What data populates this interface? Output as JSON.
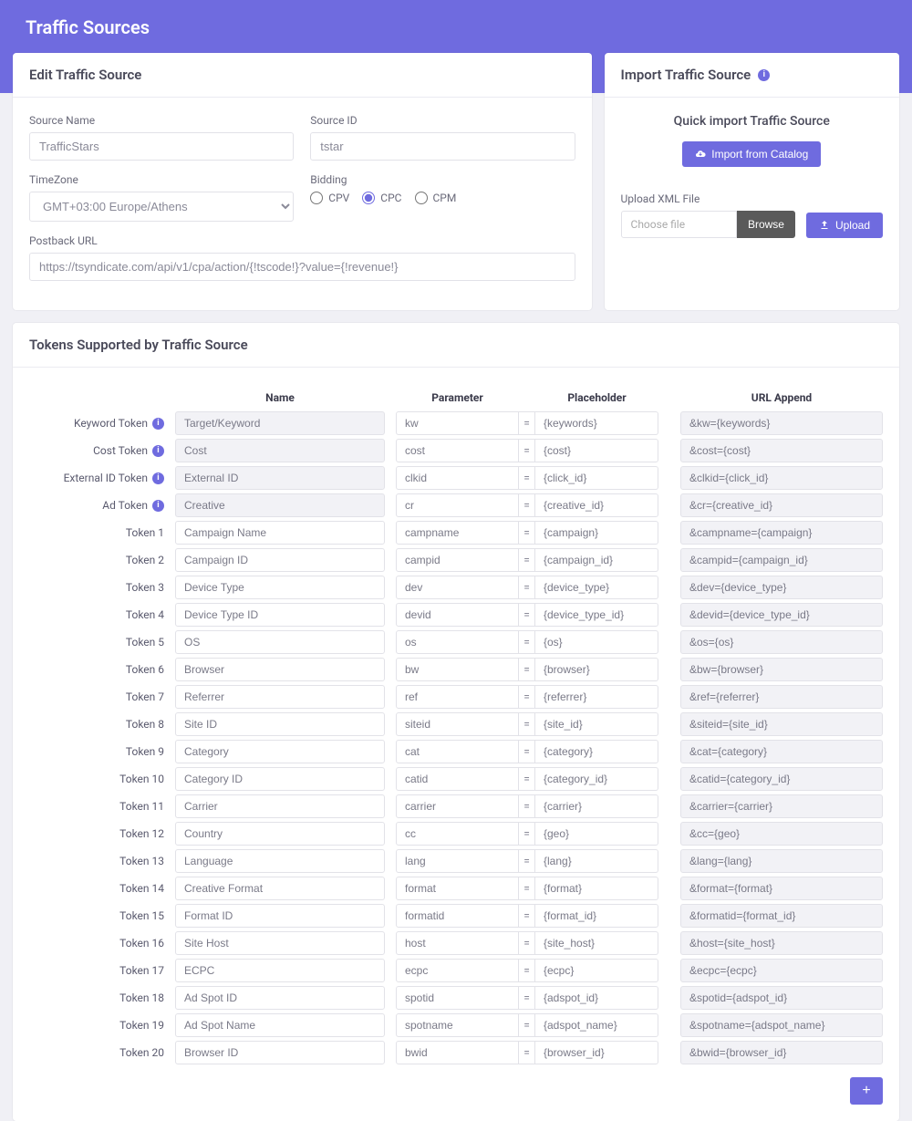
{
  "header": {
    "title": "Traffic Sources"
  },
  "edit": {
    "title": "Edit Traffic Source",
    "source_name_label": "Source Name",
    "source_name_value": "TrafficStars",
    "source_id_label": "Source ID",
    "source_id_value": "tstar",
    "timezone_label": "TimeZone",
    "timezone_value": "GMT+03:00 Europe/Athens",
    "bidding_label": "Bidding",
    "bidding_options": {
      "cpv": "CPV",
      "cpc": "CPC",
      "cpm": "CPM"
    },
    "bidding_selected": "CPC",
    "postback_label": "Postback URL",
    "postback_value": "https://tsyndicate.com/api/v1/cpa/action/{!tscode!}?value={!revenue!}"
  },
  "import": {
    "title": "Import Traffic Source",
    "quick_title": "Quick import Traffic Source",
    "catalog_btn": "Import from Catalog",
    "upload_label": "Upload XML File",
    "choose_file": "Choose file",
    "browse_btn": "Browse",
    "upload_btn": "Upload"
  },
  "tokens": {
    "title": "Tokens Supported by Traffic Source",
    "headers": {
      "name": "Name",
      "parameter": "Parameter",
      "placeholder": "Placeholder",
      "append": "URL Append"
    },
    "rows": [
      {
        "label": "Keyword Token",
        "info": true,
        "ro": true,
        "name": "Target/Keyword",
        "param": "kw",
        "plh": "{keywords}",
        "append": "&kw={keywords}"
      },
      {
        "label": "Cost Token",
        "info": true,
        "ro": true,
        "name": "Cost",
        "param": "cost",
        "plh": "{cost}",
        "append": "&cost={cost}"
      },
      {
        "label": "External ID Token",
        "info": true,
        "ro": true,
        "name": "External ID",
        "param": "clkid",
        "plh": "{click_id}",
        "append": "&clkid={click_id}"
      },
      {
        "label": "Ad Token",
        "info": true,
        "ro": true,
        "name": "Creative",
        "param": "cr",
        "plh": "{creative_id}",
        "append": "&cr={creative_id}"
      },
      {
        "label": "Token 1",
        "name": "Campaign Name",
        "param": "campname",
        "plh": "{campaign}",
        "append": "&campname={campaign}"
      },
      {
        "label": "Token 2",
        "name": "Campaign ID",
        "param": "campid",
        "plh": "{campaign_id}",
        "append": "&campid={campaign_id}"
      },
      {
        "label": "Token 3",
        "name": "Device Type",
        "param": "dev",
        "plh": "{device_type}",
        "append": "&dev={device_type}"
      },
      {
        "label": "Token 4",
        "name": "Device Type ID",
        "param": "devid",
        "plh": "{device_type_id}",
        "append": "&devid={device_type_id}"
      },
      {
        "label": "Token 5",
        "name": "OS",
        "param": "os",
        "plh": "{os}",
        "append": "&os={os}"
      },
      {
        "label": "Token 6",
        "name": "Browser",
        "param": "bw",
        "plh": "{browser}",
        "append": "&bw={browser}"
      },
      {
        "label": "Token 7",
        "name": "Referrer",
        "param": "ref",
        "plh": "{referrer}",
        "append": "&ref={referrer}"
      },
      {
        "label": "Token 8",
        "name": "Site ID",
        "param": "siteid",
        "plh": "{site_id}",
        "append": "&siteid={site_id}"
      },
      {
        "label": "Token 9",
        "name": "Category",
        "param": "cat",
        "plh": "{category}",
        "append": "&cat={category}"
      },
      {
        "label": "Token 10",
        "name": "Category ID",
        "param": "catid",
        "plh": "{category_id}",
        "append": "&catid={category_id}"
      },
      {
        "label": "Token 11",
        "name": "Carrier",
        "param": "carrier",
        "plh": "{carrier}",
        "append": "&carrier={carrier}"
      },
      {
        "label": "Token 12",
        "name": "Country",
        "param": "cc",
        "plh": "{geo}",
        "append": "&cc={geo}"
      },
      {
        "label": "Token 13",
        "name": "Language",
        "param": "lang",
        "plh": "{lang}",
        "append": "&lang={lang}"
      },
      {
        "label": "Token 14",
        "name": "Creative Format",
        "param": "format",
        "plh": "{format}",
        "append": "&format={format}"
      },
      {
        "label": "Token 15",
        "name": "Format ID",
        "param": "formatid",
        "plh": "{format_id}",
        "append": "&formatid={format_id}"
      },
      {
        "label": "Token 16",
        "name": "Site Host",
        "param": "host",
        "plh": "{site_host}",
        "append": "&host={site_host}"
      },
      {
        "label": "Token 17",
        "name": "ECPC",
        "param": "ecpc",
        "plh": "{ecpc}",
        "append": "&ecpc={ecpc}"
      },
      {
        "label": "Token 18",
        "name": "Ad Spot ID",
        "param": "spotid",
        "plh": "{adspot_id}",
        "append": "&spotid={adspot_id}"
      },
      {
        "label": "Token 19",
        "name": "Ad Spot Name",
        "param": "spotname",
        "plh": "{adspot_name}",
        "append": "&spotname={adspot_name}"
      },
      {
        "label": "Token 20",
        "name": "Browser ID",
        "param": "bwid",
        "plh": "{browser_id}",
        "append": "&bwid={browser_id}"
      }
    ]
  },
  "add_btn": "+"
}
